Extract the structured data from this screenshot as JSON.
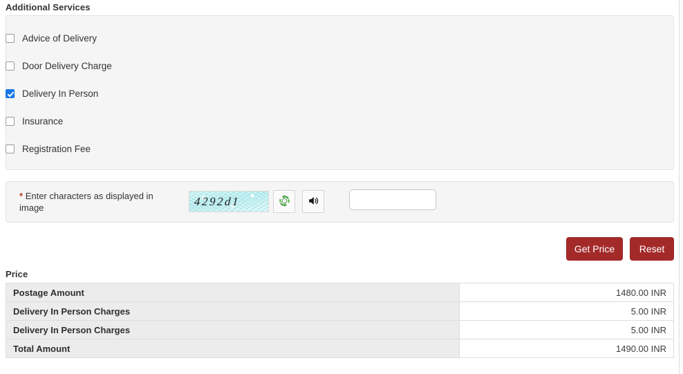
{
  "sections": {
    "additional_services_heading": "Additional Services",
    "price_heading": "Price"
  },
  "additional_services": {
    "items": [
      {
        "label": "Advice of Delivery",
        "checked": false
      },
      {
        "label": "Door Delivery Charge",
        "checked": false
      },
      {
        "label": "Delivery In Person",
        "checked": true
      },
      {
        "label": "Insurance",
        "checked": false
      },
      {
        "label": "Registration Fee",
        "checked": false
      }
    ]
  },
  "captcha": {
    "required_marker": "*",
    "label": "Enter characters as displayed in image",
    "image_text": "4292d1",
    "refresh_icon": "refresh-icon",
    "audio_icon": "speaker-icon",
    "input_value": "",
    "input_placeholder": ""
  },
  "actions": {
    "get_price_label": "Get Price",
    "reset_label": "Reset",
    "button_color": "#a42a2a"
  },
  "price_table": {
    "rows": [
      {
        "label": "Postage Amount",
        "value": "1480.00 INR"
      },
      {
        "label": "Delivery In Person Charges",
        "value": "5.00 INR"
      },
      {
        "label": "Delivery In Person Charges",
        "value": "5.00 INR"
      },
      {
        "label": "Total Amount",
        "value": "1490.00 INR"
      }
    ]
  },
  "colors": {
    "panel_background": "#f5f5f5",
    "panel_border": "#e3e3e3",
    "checkbox_checked": "#1877e8",
    "required_asterisk": "#c0392b",
    "table_label_background": "#ececec"
  }
}
